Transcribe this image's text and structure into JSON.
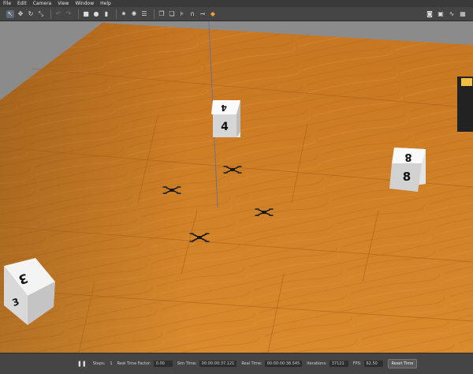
{
  "menu": [
    "File",
    "Edit",
    "Camera",
    "View",
    "Window",
    "Help"
  ],
  "toolbar": {
    "left_icons": [
      "select-arrow-icon",
      "translate-icon",
      "rotate-icon",
      "scale-icon",
      "undo-icon",
      "redo-icon",
      "box-icon",
      "sphere-icon",
      "cylinder-icon",
      "point-light-icon",
      "spot-light-icon",
      "directional-light-icon",
      "copy-icon",
      "paste-icon",
      "align-icon",
      "snap-icon",
      "joint-icon",
      "orange-view-icon"
    ],
    "right_icons": [
      "camera-icon",
      "video-icon",
      "plot-icon",
      "grid-icon"
    ]
  },
  "scene": {
    "boxes": [
      {
        "label_top": "4",
        "label_front": "4"
      },
      {
        "label_top": "8",
        "label_front": "8"
      },
      {
        "label_top": "3",
        "label_front": "3"
      }
    ]
  },
  "status": {
    "steps_label": "Steps:",
    "steps_value": "1",
    "rtf_label": "Real Time Factor:",
    "rtf_value": "0.00",
    "sim_time_label": "Sim Time:",
    "sim_time_value": "00:00:00:37.121",
    "real_time_label": "Real Time:",
    "real_time_value": "00:00:00:38.545",
    "iterations_label": "Iterations:",
    "iterations_value": "37121",
    "fps_label": "FPS:",
    "fps_value": "62.50",
    "reset_label": "Reset Time"
  },
  "colors": {
    "floor": "#c9781f",
    "floor_dark": "#a65a14",
    "background": "#8a8a8a",
    "ui_dark": "#3a3a3a"
  }
}
